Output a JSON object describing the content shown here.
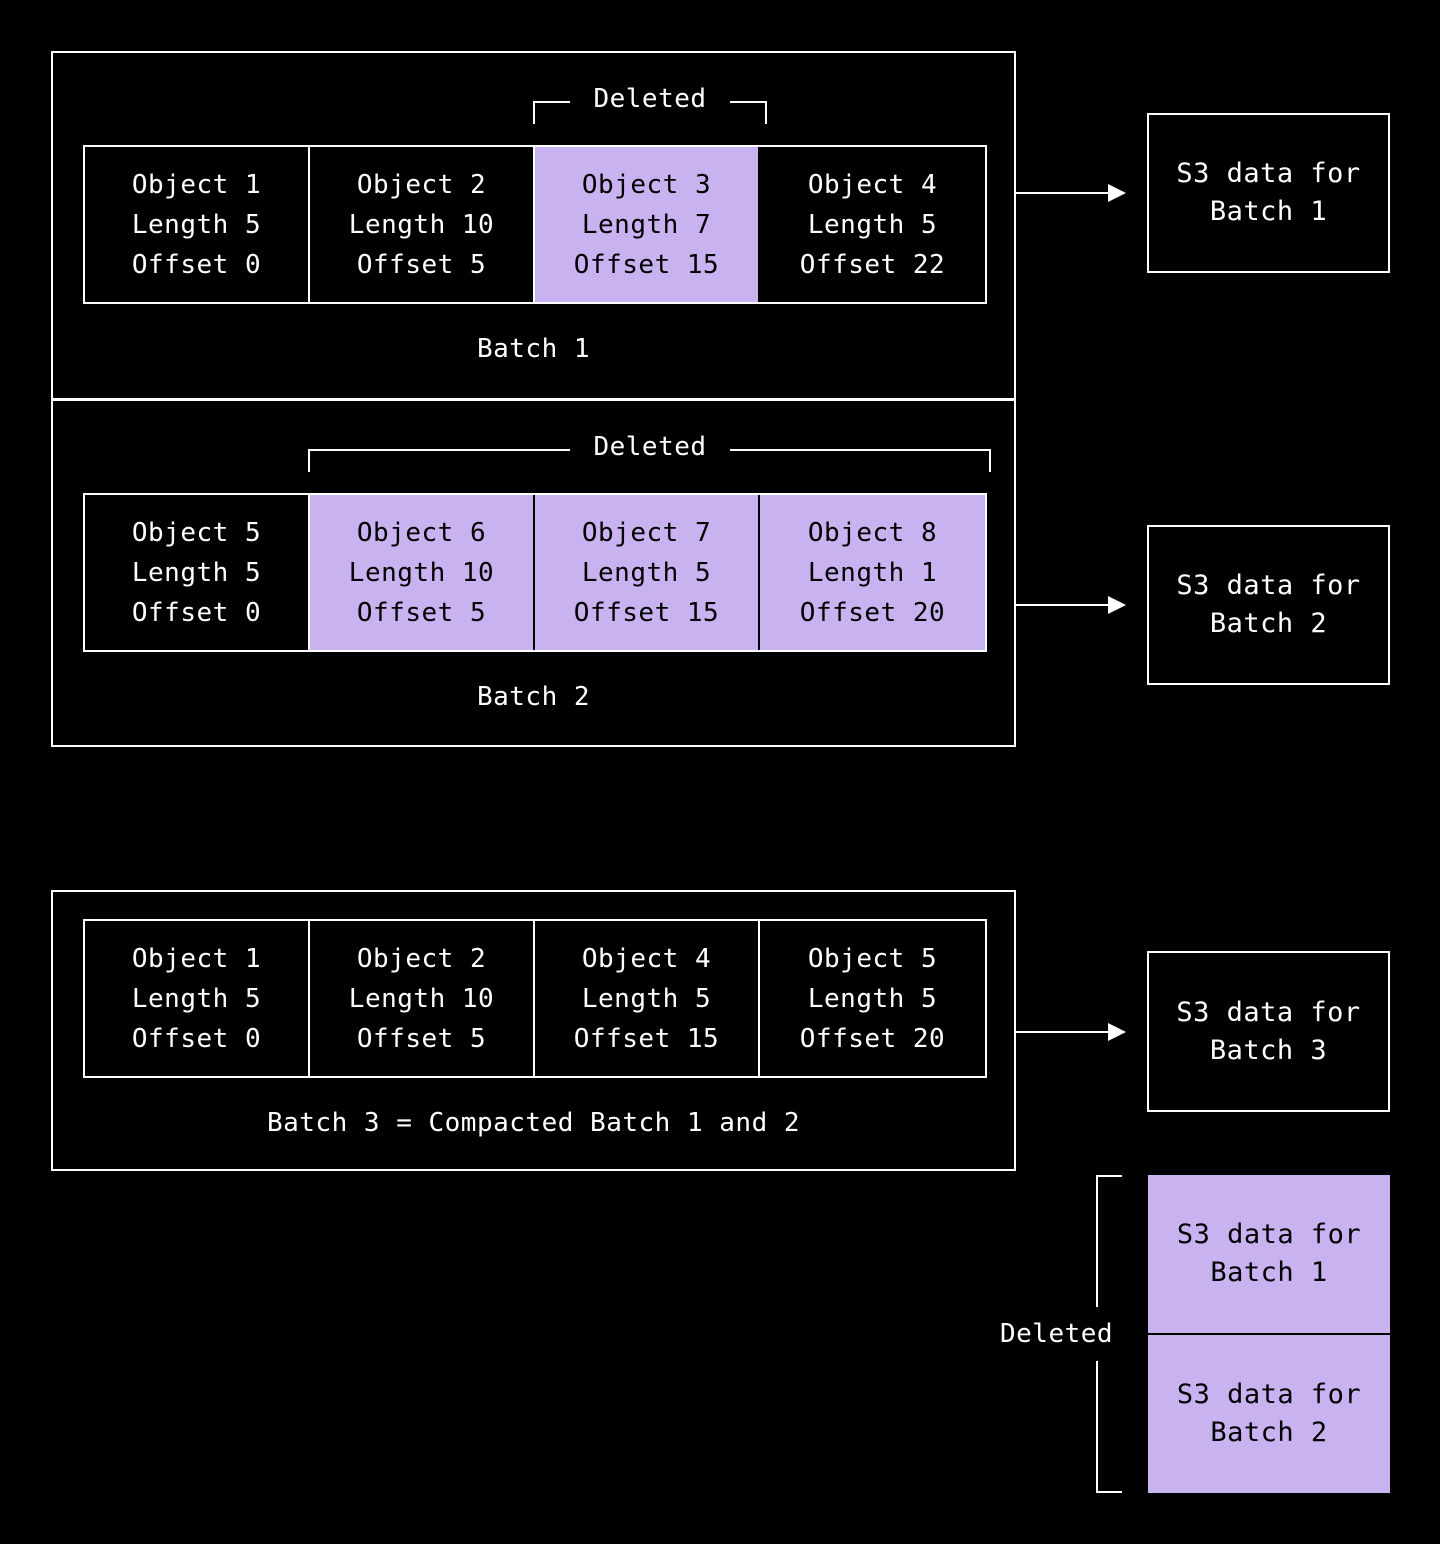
{
  "colors": {
    "background": "#000000",
    "stroke": "#ffffff",
    "deleted_fill": "#c8b2f0",
    "deleted_text": "#000000"
  },
  "labels": {
    "deleted": "Deleted"
  },
  "batches": [
    {
      "caption": "Batch 1",
      "objects": [
        {
          "name": "Object 1",
          "length": "Length 5",
          "offset": "Offset 0",
          "deleted": false
        },
        {
          "name": "Object 2",
          "length": "Length 10",
          "offset": "Offset 5",
          "deleted": false
        },
        {
          "name": "Object 3",
          "length": "Length 7",
          "offset": "Offset 15",
          "deleted": true
        },
        {
          "name": "Object 4",
          "length": "Length 5",
          "offset": "Offset 22",
          "deleted": false
        }
      ]
    },
    {
      "caption": "Batch 2",
      "objects": [
        {
          "name": "Object 5",
          "length": "Length 5",
          "offset": "Offset 0",
          "deleted": false
        },
        {
          "name": "Object 6",
          "length": "Length 10",
          "offset": "Offset 5",
          "deleted": true
        },
        {
          "name": "Object 7",
          "length": "Length 5",
          "offset": "Offset 15",
          "deleted": true
        },
        {
          "name": "Object 8",
          "length": "Length 1",
          "offset": "Offset 20",
          "deleted": true
        }
      ]
    },
    {
      "caption": "Batch 3 = Compacted Batch 1 and 2",
      "objects": [
        {
          "name": "Object 1",
          "length": "Length 5",
          "offset": "Offset 0",
          "deleted": false
        },
        {
          "name": "Object 2",
          "length": "Length 10",
          "offset": "Offset 5",
          "deleted": false
        },
        {
          "name": "Object 4",
          "length": "Length 5",
          "offset": "Offset 15",
          "deleted": false
        },
        {
          "name": "Object 5",
          "length": "Length 5",
          "offset": "Offset 20",
          "deleted": false
        }
      ]
    }
  ],
  "s3_boxes": [
    {
      "line1": "S3 data for",
      "line2": "Batch 1",
      "deleted": false
    },
    {
      "line1": "S3 data for",
      "line2": "Batch 2",
      "deleted": false
    },
    {
      "line1": "S3 data for",
      "line2": "Batch 3",
      "deleted": false
    },
    {
      "line1": "S3 data for",
      "line2": "Batch 1",
      "deleted": true
    },
    {
      "line1": "S3 data for",
      "line2": "Batch 2",
      "deleted": true
    }
  ]
}
